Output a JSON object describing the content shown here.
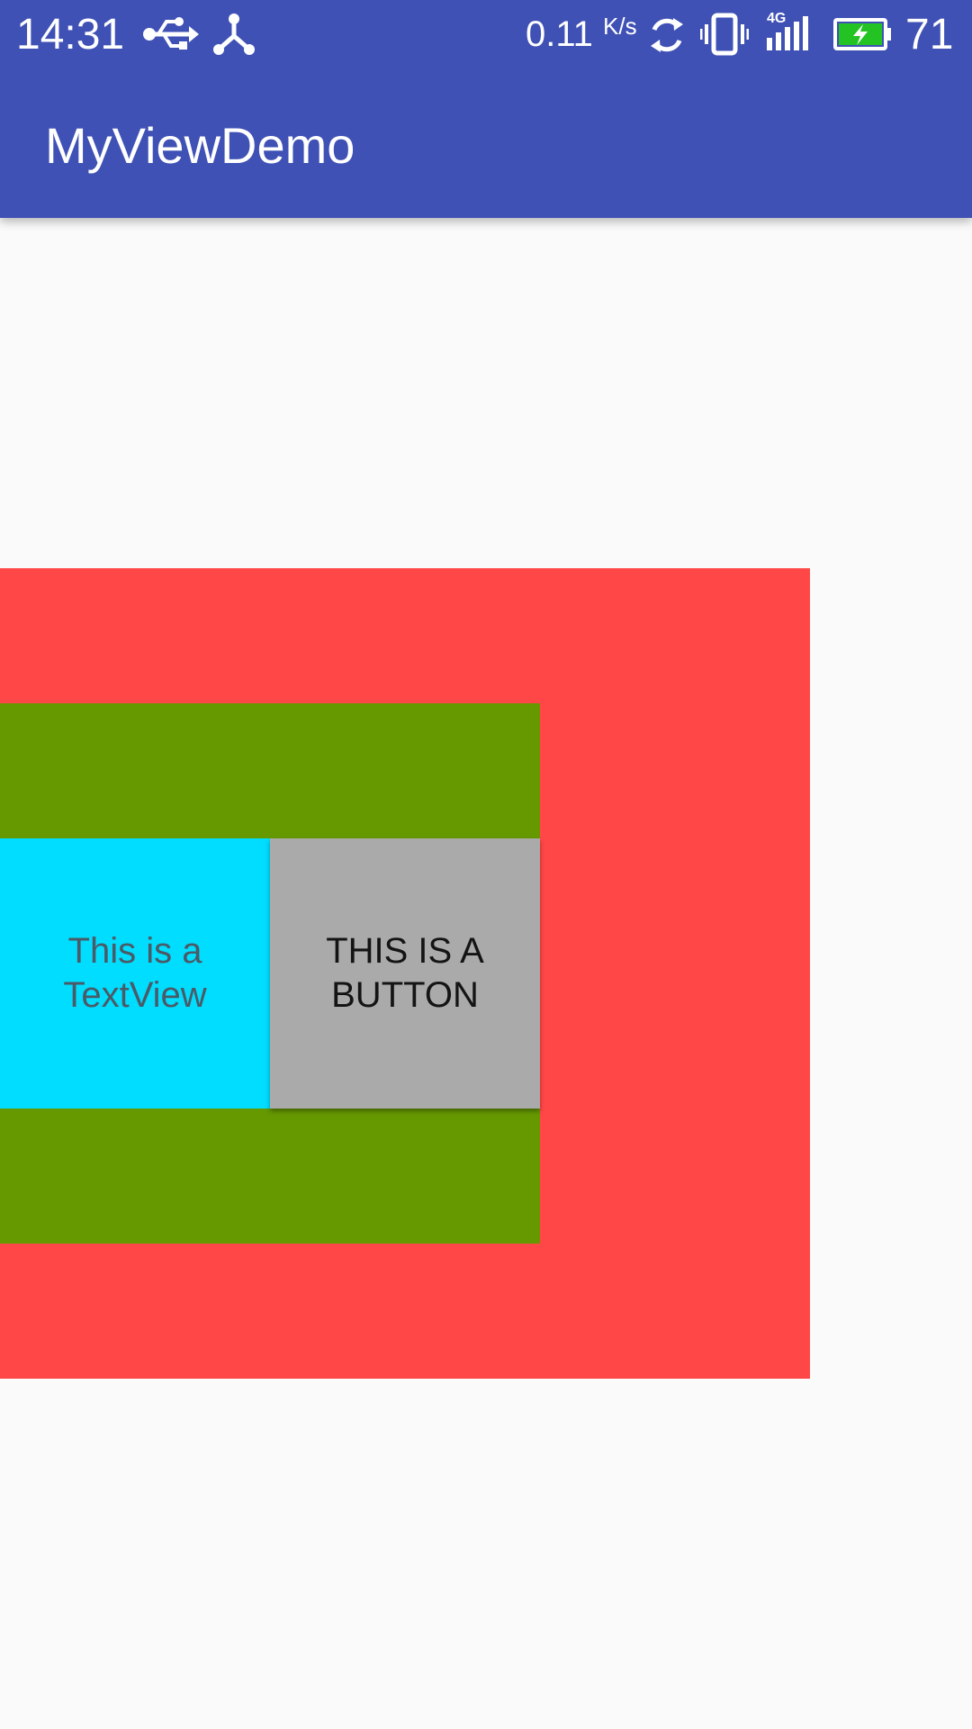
{
  "status_bar": {
    "time": "14:31",
    "speed": "0.11",
    "speed_unit": "K/s",
    "network_type": "4G",
    "battery_level": "71",
    "icons": [
      "usb-icon",
      "share-icon",
      "sync-icon",
      "vibrate-icon",
      "signal-icon",
      "battery-charging-icon"
    ]
  },
  "app_bar": {
    "title": "MyViewDemo"
  },
  "views": {
    "textview_text": "This is a\nTextView",
    "button_label": "THIS IS A\nBUTTON"
  },
  "colors": {
    "app_bar": "#3f51b5",
    "outer_view": "#ff4747",
    "middle_view": "#669900",
    "textview": "#00ddff",
    "button": "#aaaaaa",
    "background": "#fafafa"
  }
}
